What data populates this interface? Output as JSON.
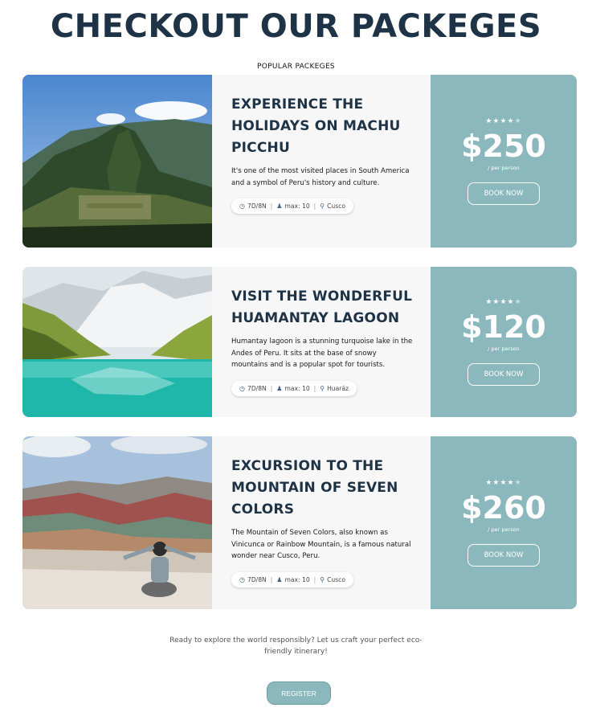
{
  "page": {
    "title": "CHECKOUT OUR PACKEGES",
    "subtitle": "POPULAR PACKEGES"
  },
  "colors": {
    "title": "#1f3346",
    "price_panel": "#8bb8bc",
    "meta_icon": "#3d5f8f"
  },
  "packages": [
    {
      "image_icon": "machu-picchu-photo",
      "title": "EXPERIENCE THE HOLIDAYS ON MACHU PICCHU",
      "description": "It's one of the most visited places in South America and a symbol of Peru's history and culture.",
      "duration": "7D/8N",
      "max": "max: 10",
      "location": "Cusco",
      "rating": 4,
      "stars_full": "★★★★",
      "stars_empty": "★",
      "price": "$250",
      "per": "/ per person",
      "button": "BOOK NOW"
    },
    {
      "image_icon": "lagoon-photo",
      "title": "VISIT THE WONDERFUL HUAMANTAY LAGOON",
      "description": "Humantay lagoon is a stunning turquoise lake in the Andes of Peru. It sits at the base of snowy mountains and is a popular spot for tourists.",
      "duration": "7D/8N",
      "max": "max: 10",
      "location": "Huaráz",
      "rating": 4,
      "stars_full": "★★★★",
      "stars_empty": "★",
      "price": "$120",
      "per": "/ per person",
      "button": "BOOK NOW"
    },
    {
      "image_icon": "rainbow-mountain-photo",
      "title": "EXCURSION TO THE MOUNTAIN OF SEVEN COLORS",
      "description": "The Mountain of Seven Colors, also known as Vinicunca or Rainbow Mountain, is a famous natural wonder near Cusco, Peru.",
      "duration": "7D/8N",
      "max": "max: 10",
      "location": "Cusco",
      "rating": 4,
      "stars_full": "★★★★",
      "stars_empty": "★",
      "price": "$260",
      "per": "/ per person",
      "button": "BOOK NOW"
    }
  ],
  "cta": {
    "text": "Ready to explore the world responsibly? Let us craft your perfect eco-friendly itinerary!",
    "button": "REGISTER"
  }
}
